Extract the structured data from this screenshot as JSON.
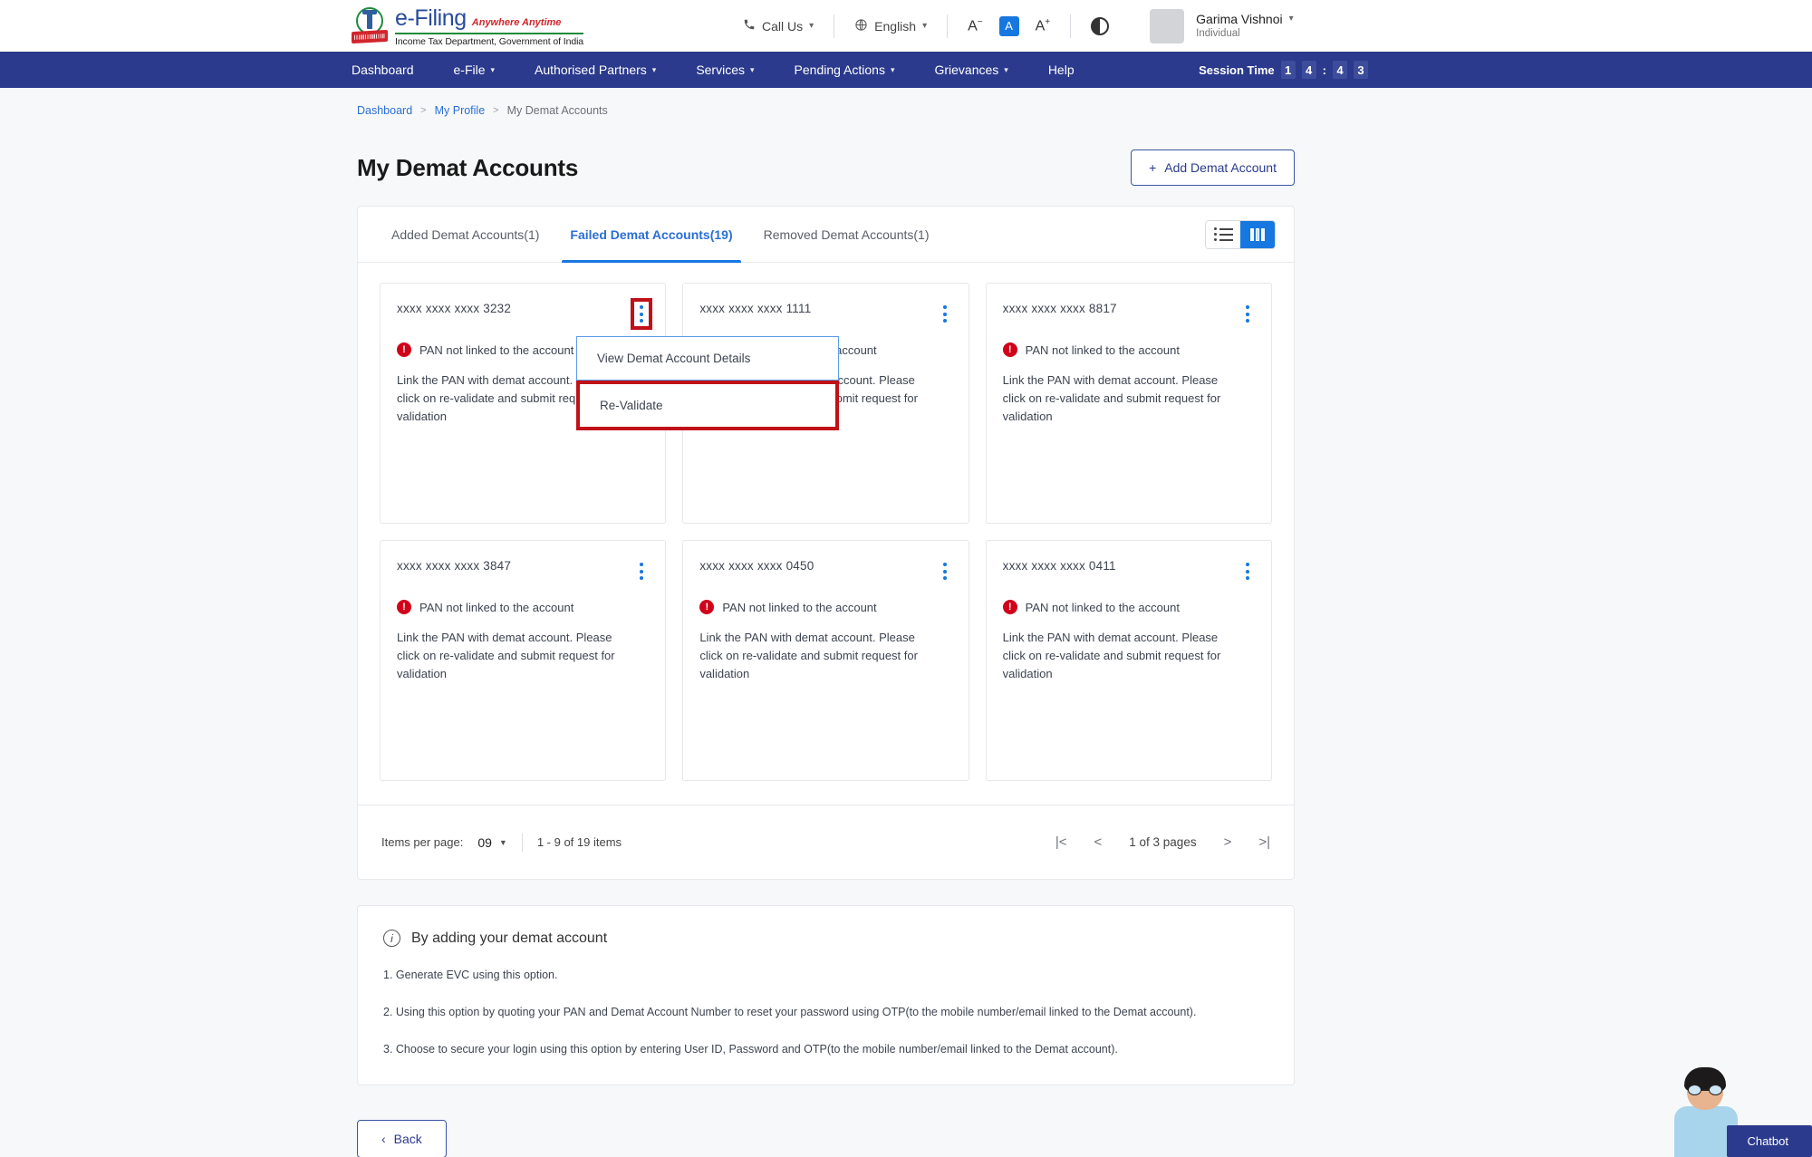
{
  "header": {
    "logo": {
      "brand": "e-Filing",
      "tagline": "Anywhere Anytime",
      "subtitle": "Income Tax Department, Government of India"
    },
    "call_us": "Call Us",
    "language": "English",
    "font_decrease": "A",
    "font_normal": "A",
    "font_increase": "A",
    "user_name": "Garima Vishnoi",
    "user_role": "Individual"
  },
  "nav": {
    "items": [
      {
        "label": "Dashboard",
        "has_caret": false
      },
      {
        "label": "e-File",
        "has_caret": true
      },
      {
        "label": "Authorised Partners",
        "has_caret": true
      },
      {
        "label": "Services",
        "has_caret": true
      },
      {
        "label": "Pending Actions",
        "has_caret": true
      },
      {
        "label": "Grievances",
        "has_caret": true
      },
      {
        "label": "Help",
        "has_caret": false
      }
    ],
    "session_label": "Session Time",
    "session_digits": [
      "1",
      "4",
      "4",
      "3"
    ],
    "session_colon": ":"
  },
  "breadcrumb": {
    "item1": "Dashboard",
    "item2": "My Profile",
    "current": "My Demat Accounts",
    "sep": ">"
  },
  "page": {
    "title": "My Demat Accounts",
    "add_button": "Add Demat Account",
    "add_icon": "+"
  },
  "tabs": [
    {
      "label": "Added Demat Accounts(1)",
      "active": false
    },
    {
      "label": "Failed Demat Accounts(19)",
      "active": true
    },
    {
      "label": "Removed Demat Accounts(1)",
      "active": false
    }
  ],
  "view_toggle": {
    "list_view": "list-view-icon",
    "grid_view": "grid-view-icon",
    "active": "grid"
  },
  "cards": [
    {
      "account": "xxxx xxxx xxxx 3232",
      "status": "PAN not linked to the account",
      "description": "Link the PAN with demat account. Please click on re-validate and submit request for validation"
    },
    {
      "account": "xxxx xxxx xxxx 1111",
      "status": "PAN not linked to the account",
      "description": "Link the PAN with demat account. Please click on re-validate and submit request for validation"
    },
    {
      "account": "xxxx xxxx xxxx 8817",
      "status": "PAN not linked to the account",
      "description": "Link the PAN with demat account. Please click on re-validate and submit request for validation"
    },
    {
      "account": "xxxx xxxx xxxx 3847",
      "status": "PAN not linked to the account",
      "description": "Link the PAN with demat account. Please click on re-validate and submit request for validation"
    },
    {
      "account": "xxxx xxxx xxxx 0450",
      "status": "PAN not linked to the account",
      "description": "Link the PAN with demat account. Please click on re-validate and submit request for validation"
    },
    {
      "account": "xxxx xxxx xxxx 0411",
      "status": "PAN not linked to the account",
      "description": "Link the PAN with demat account. Please click on re-validate and submit request for validation"
    }
  ],
  "dropdown": {
    "view_details": "View Demat Account Details",
    "revalidate": "Re-Validate"
  },
  "pagination": {
    "items_per_page_label": "Items per page:",
    "items_per_page_value": "09",
    "range_text": "1 - 9 of 19 items",
    "page_text": "1 of 3 pages",
    "first": "|<",
    "prev": "<",
    "next": ">",
    "last": ">|"
  },
  "info": {
    "title": "By adding your demat account",
    "lines": [
      "1. Generate EVC using this option.",
      "2. Using this option by quoting your PAN and Demat Account Number to reset your password using OTP(to the mobile number/email linked to the Demat account).",
      "3. Choose to secure your login using this option by entering User ID, Password and OTP(to the mobile number/email linked to the Demat account)."
    ]
  },
  "footer": {
    "back_label": "Back",
    "back_icon": "‹"
  },
  "chatbot": {
    "label": "Chatbot"
  },
  "colors": {
    "nav_blue": "#2b3a8c",
    "accent_blue": "#1677e0",
    "link_blue": "#2a6fd6",
    "error_red": "#d0021b",
    "highlight_red": "#c01118",
    "page_bg": "#f7f8fa"
  }
}
